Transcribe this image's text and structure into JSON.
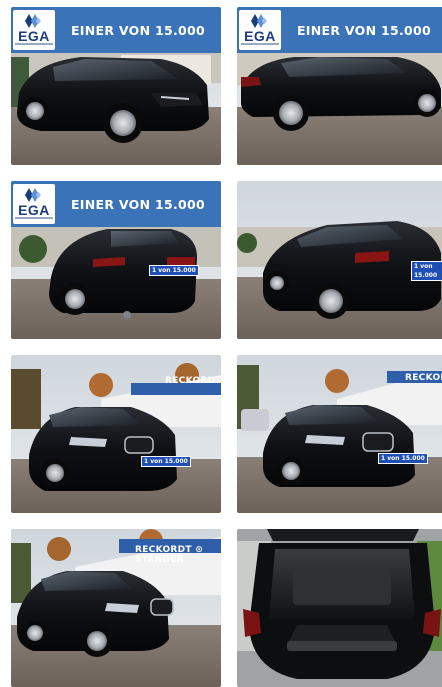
{
  "gallery": {
    "banner_text": "EINER VON 15.000",
    "logo_text": "EGA",
    "plate_text": "1 von 15.000",
    "dealer_sign_1": "RECKORDT",
    "dealer_sign_2": "RECKORDT",
    "dealer_sign_3": "RECKORDT ⊙ STÄNDER"
  }
}
